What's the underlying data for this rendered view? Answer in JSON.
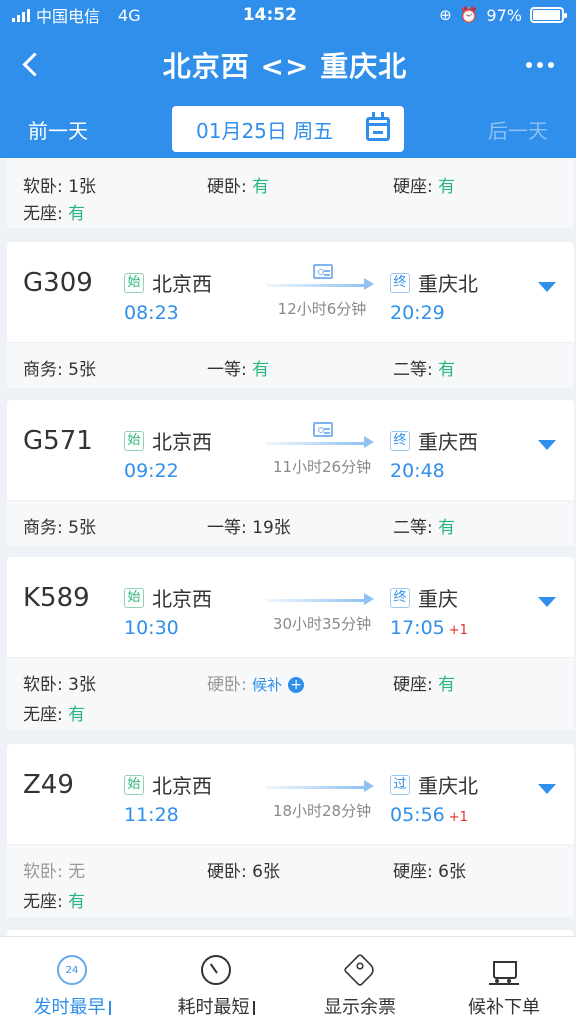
{
  "status_bar": {
    "carrier": "中国电信",
    "network": "4G",
    "time": "14:52",
    "battery": "97%",
    "battery_level": 0.97
  },
  "header": {
    "title": "北京西 <> 重庆北"
  },
  "date_bar": {
    "prev": "前一天",
    "date": "01月25日 周五",
    "next": "后一天"
  },
  "partial_card": {
    "seats": [
      {
        "label": "软卧: ",
        "value": "1张",
        "color": "black"
      },
      {
        "label": "硬卧: ",
        "value": "有",
        "color": "green"
      },
      {
        "label": "硬座: ",
        "value": "有",
        "color": "green"
      },
      {
        "label": "无座: ",
        "value": "有",
        "color": "green"
      }
    ]
  },
  "trains": [
    {
      "number": "G309",
      "from_tag": "始",
      "from": "北京西",
      "depart": "08:23",
      "to_tag": "终",
      "to": "重庆北",
      "arrive": "20:29",
      "next_day": "",
      "duration": "12小时6分钟",
      "id_card": true,
      "seats": [
        {
          "label": "商务: ",
          "value": "5张",
          "color": "black"
        },
        {
          "label": "一等: ",
          "value": "有",
          "color": "green"
        },
        {
          "label": "二等: ",
          "value": "有",
          "color": "green"
        }
      ]
    },
    {
      "number": "G571",
      "from_tag": "始",
      "from": "北京西",
      "depart": "09:22",
      "to_tag": "终",
      "to": "重庆西",
      "arrive": "20:48",
      "next_day": "",
      "duration": "11小时26分钟",
      "id_card": true,
      "seats": [
        {
          "label": "商务: ",
          "value": "5张",
          "color": "black"
        },
        {
          "label": "一等: ",
          "value": "19张",
          "color": "black"
        },
        {
          "label": "二等: ",
          "value": "有",
          "color": "green"
        }
      ]
    },
    {
      "number": "K589",
      "from_tag": "始",
      "from": "北京西",
      "depart": "10:30",
      "to_tag": "终",
      "to": "重庆",
      "arrive": "17:05",
      "next_day": "+1",
      "duration": "30小时35分钟",
      "id_card": false,
      "seats": [
        {
          "label": "软卧: ",
          "value": "3张",
          "color": "black"
        },
        {
          "label": "硬卧: ",
          "value": "候补",
          "color": "blue",
          "plus": true
        },
        {
          "label": "硬座: ",
          "value": "有",
          "color": "green"
        },
        {
          "label": "无座: ",
          "value": "有",
          "color": "green"
        }
      ]
    },
    {
      "number": "Z49",
      "from_tag": "始",
      "from": "北京西",
      "depart": "11:28",
      "to_tag": "过",
      "to": "重庆北",
      "arrive": "05:56",
      "next_day": "+1",
      "duration": "18小时28分钟",
      "id_card": false,
      "seats": [
        {
          "label": "软卧: ",
          "value": "无",
          "color": "gray"
        },
        {
          "label": "硬卧: ",
          "value": "6张",
          "color": "black"
        },
        {
          "label": "硬座: ",
          "value": "6张",
          "color": "black"
        },
        {
          "label": "无座: ",
          "value": "有",
          "color": "green"
        }
      ]
    }
  ],
  "toolbar": {
    "items": [
      {
        "label": "发时最早",
        "icon": "clock-24-icon",
        "icon_text": "24",
        "active": true
      },
      {
        "label": "耗时最短",
        "icon": "gauge-icon",
        "active": false
      },
      {
        "label": "显示余票",
        "icon": "ticket-tag-icon",
        "active": false
      },
      {
        "label": "候补下单",
        "icon": "cart-icon",
        "active": false
      }
    ]
  },
  "colors": {
    "primary": "#2f8fea",
    "green": "#2ab67a",
    "red": "#e0302b",
    "gray": "#999999"
  }
}
